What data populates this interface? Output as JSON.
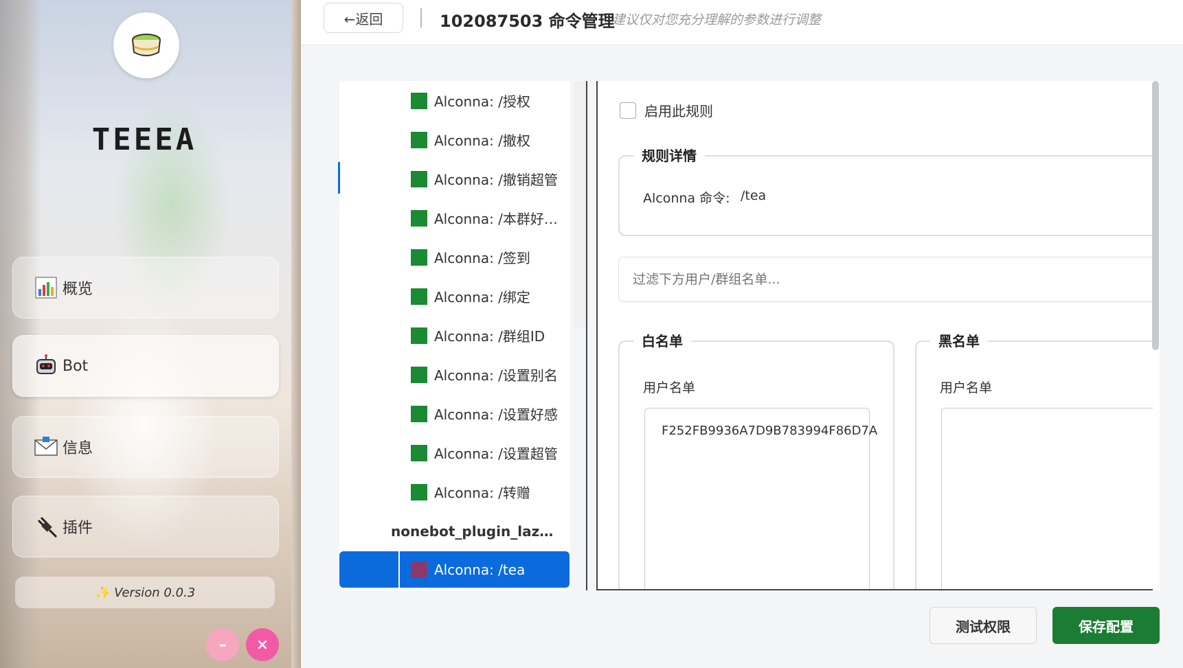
{
  "sidebar": {
    "brand": "TEEEA",
    "nav": [
      {
        "label": "概览",
        "icon": "chart-icon"
      },
      {
        "label": "Bot",
        "icon": "robot-icon"
      },
      {
        "label": "信息",
        "icon": "mail-icon"
      },
      {
        "label": "插件",
        "icon": "plug-icon"
      }
    ],
    "version": "Version 0.0.3",
    "minimize_symbol": "–",
    "close_symbol": "×"
  },
  "header": {
    "back_label": "←返回",
    "title": "102087503 命令管理",
    "subtitle": "建议仅对您充分理解的参数进行调整"
  },
  "commands": {
    "items": [
      "Alconna: /授权",
      "Alconna: /撤权",
      "Alconna: /撤销超管",
      "Alconna: /本群好感...",
      "Alconna: /签到",
      "Alconna: /绑定",
      "Alconna: /群组ID",
      "Alconna: /设置别名",
      "Alconna: /设置好感",
      "Alconna: /设置超管",
      "Alconna: /转赠"
    ],
    "group": "nonebot_plugin_lazytea_s...",
    "selected": "Alconna: /tea"
  },
  "rule": {
    "enable_label": "启用此规则",
    "details_legend": "规则详情",
    "command_label": "Alconna 命令:",
    "command_value": "/tea",
    "filter_placeholder": "过滤下方用户/群组名单...",
    "whitelist_legend": "白名单",
    "blacklist_legend": "黑名单",
    "whitelist_user_label": "用户名单",
    "blacklist_user_label": "用户名单",
    "whitelist_users": [
      "F252FB9936A7D9B783994F86D7A"
    ]
  },
  "footer": {
    "test_label": "测试权限",
    "save_label": "保存配置"
  },
  "colors": {
    "accent": "#0c6bdc",
    "save_green": "#1b7d33",
    "command_square": "#1a8a33",
    "selected_square": "#8a3a6a",
    "minimize_pink": "#f7a6c0",
    "close_pink": "#f25aa6"
  }
}
